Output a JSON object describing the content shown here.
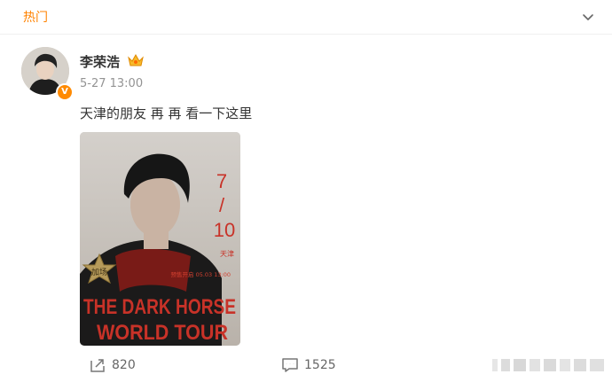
{
  "section": {
    "label": "热门"
  },
  "post": {
    "author": "李荣浩",
    "timestamp": "5-27 13:00",
    "text": "天津的朋友 再 再 看一下这里",
    "poster": {
      "date_lines": [
        "7",
        "/",
        "10"
      ],
      "city": "天津",
      "sale_line": "预售开启 05.03 13:00",
      "badge": "加场",
      "title_line1": "THE DARK HORSE",
      "title_line2": "WORLD TOUR"
    },
    "stats": {
      "reposts": "820",
      "comments": "1525"
    }
  },
  "colors": {
    "accent": "#ff8200",
    "poster_red": "#c83228",
    "verified": "#ff8a00"
  },
  "icons": [
    "chevron-down-icon",
    "crown-icon",
    "verified-icon",
    "repost-icon",
    "comment-icon"
  ]
}
